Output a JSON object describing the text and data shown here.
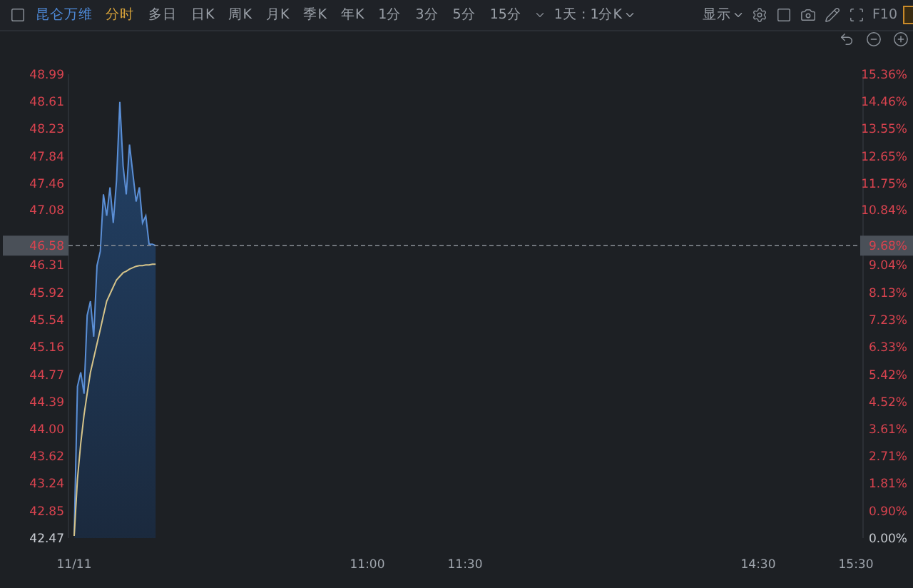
{
  "toolbar": {
    "stock_name": "昆仑万维",
    "tabs": [
      {
        "label": "分时",
        "selected": true
      },
      {
        "label": "多日",
        "selected": false
      },
      {
        "label": "日K",
        "selected": false
      },
      {
        "label": "周K",
        "selected": false
      },
      {
        "label": "月K",
        "selected": false
      },
      {
        "label": "季K",
        "selected": false
      },
      {
        "label": "年K",
        "selected": false
      },
      {
        "label": "1分",
        "selected": false
      },
      {
        "label": "3分",
        "selected": false
      },
      {
        "label": "5分",
        "selected": false
      },
      {
        "label": "15分",
        "selected": false
      }
    ],
    "period_select": "1天 : 1分K",
    "display_menu": "显示",
    "f10": "F10"
  },
  "chart": {
    "chart_data": {
      "type": "line",
      "categories": [
        "11/11",
        null,
        null,
        null,
        null,
        null,
        null,
        null,
        null,
        null,
        null,
        null,
        null,
        null,
        null,
        null,
        null,
        null,
        null,
        null,
        null,
        null,
        null,
        null,
        null,
        null,
        null,
        null,
        null,
        null,
        null,
        null,
        null,
        null,
        null,
        null,
        null,
        null,
        null,
        null,
        null,
        null,
        null,
        null,
        null,
        null,
        null,
        null,
        null,
        null,
        null,
        null,
        null,
        null,
        null,
        null,
        null,
        null,
        null,
        null,
        null,
        null,
        null,
        null,
        null,
        null,
        null,
        null,
        null,
        null,
        null,
        null,
        null,
        null,
        null,
        null,
        null,
        null,
        null,
        null,
        null,
        null,
        null,
        null,
        null,
        null,
        null,
        null,
        null,
        null,
        "11:00",
        null,
        null,
        null,
        null,
        null,
        null,
        null,
        null,
        null,
        null,
        null,
        null,
        null,
        null,
        null,
        null,
        null,
        null,
        null,
        null,
        null,
        null,
        null,
        null,
        null,
        null,
        null,
        null,
        null,
        "11:30",
        null,
        null,
        null,
        null,
        null,
        null,
        null,
        null,
        null,
        null,
        null,
        null,
        null,
        null,
        null,
        null,
        null,
        null,
        null,
        null,
        null,
        null,
        null,
        null,
        null,
        null,
        null,
        null,
        null,
        null,
        null,
        null,
        null,
        null,
        null,
        null,
        null,
        null,
        null,
        null,
        null,
        null,
        null,
        null,
        null,
        null,
        null,
        null,
        null,
        null,
        null,
        null,
        null,
        null,
        null,
        null,
        null,
        null,
        null,
        null,
        null,
        null,
        null,
        null,
        null,
        null,
        null,
        null,
        null,
        null,
        null,
        null,
        null,
        null,
        null,
        null,
        null,
        null,
        null,
        null,
        null,
        null,
        null,
        null,
        null,
        null,
        null,
        null,
        null,
        "14:30",
        null,
        null,
        null,
        null,
        null,
        null,
        null,
        null,
        null,
        null,
        null,
        null,
        null,
        null,
        null,
        null,
        null,
        null,
        null,
        null,
        null,
        null,
        null,
        null,
        null,
        null,
        null,
        null,
        null,
        "15:30"
      ],
      "series": [
        {
          "color": "#5b8fd6",
          "values": [
            42.5,
            44.6,
            44.8,
            44.5,
            45.6,
            45.8,
            45.3,
            46.3,
            46.5,
            47.3,
            47.0,
            47.4,
            46.9,
            47.5,
            48.6,
            47.7,
            47.3,
            48.0,
            47.6,
            47.2,
            47.4,
            46.9,
            47.0,
            46.6,
            46.6,
            46.58,
            null,
            null,
            null,
            null,
            null,
            null,
            null,
            null,
            null,
            null,
            null,
            null,
            null,
            null,
            null,
            null,
            null,
            null,
            null,
            null,
            null,
            null,
            null,
            null,
            null,
            null,
            null,
            null,
            null,
            null,
            null,
            null,
            null,
            null,
            null,
            null,
            null,
            null,
            null,
            null,
            null,
            null,
            null,
            null,
            null,
            null,
            null,
            null,
            null,
            null,
            null,
            null,
            null,
            null,
            null,
            null,
            null,
            null,
            null,
            null,
            null,
            null,
            null,
            null,
            null,
            null,
            null,
            null,
            null,
            null,
            null,
            null,
            null,
            null,
            null,
            null,
            null,
            null,
            null,
            null,
            null,
            null,
            null,
            null,
            null,
            null,
            null,
            null,
            null,
            null,
            null,
            null,
            null,
            null,
            null,
            null,
            null,
            null,
            null,
            null,
            null,
            null,
            null,
            null,
            null,
            null,
            null,
            null,
            null,
            null,
            null,
            null,
            null,
            null,
            null,
            null,
            null,
            null,
            null,
            null,
            null,
            null,
            null,
            null,
            null,
            null,
            null,
            null,
            null,
            null,
            null,
            null,
            null,
            null,
            null,
            null,
            null,
            null,
            null,
            null,
            null,
            null,
            null,
            null,
            null,
            null,
            null,
            null,
            null,
            null,
            null,
            null,
            null,
            null,
            null,
            null,
            null,
            null,
            null,
            null,
            null,
            null,
            null,
            null,
            null,
            null,
            null,
            null,
            null,
            null,
            null,
            null,
            null,
            null,
            null,
            null,
            null,
            null,
            null,
            null,
            null,
            null,
            null,
            null,
            null,
            null,
            null,
            null,
            null,
            null,
            null,
            null,
            null,
            null,
            null,
            null,
            null,
            null,
            null,
            null,
            null,
            null,
            null,
            null,
            null,
            null,
            null,
            null,
            null,
            null,
            null,
            null,
            null,
            null,
            null
          ]
        },
        {
          "color": "#d6c48a",
          "values": [
            42.5,
            43.3,
            43.8,
            44.2,
            44.5,
            44.8,
            45.0,
            45.2,
            45.4,
            45.6,
            45.8,
            45.9,
            46.0,
            46.1,
            46.15,
            46.2,
            46.22,
            46.25,
            46.27,
            46.29,
            46.3,
            46.3,
            46.31,
            46.31,
            46.32,
            46.32,
            null,
            null,
            null,
            null,
            null,
            null,
            null,
            null,
            null,
            null,
            null,
            null,
            null,
            null,
            null,
            null,
            null,
            null,
            null,
            null,
            null,
            null,
            null,
            null,
            null,
            null,
            null,
            null,
            null,
            null,
            null,
            null,
            null,
            null,
            null,
            null,
            null,
            null,
            null,
            null,
            null,
            null,
            null,
            null,
            null,
            null,
            null,
            null,
            null,
            null,
            null,
            null,
            null,
            null,
            null,
            null,
            null,
            null,
            null,
            null,
            null,
            null,
            null,
            null,
            null,
            null,
            null,
            null,
            null,
            null,
            null,
            null,
            null,
            null,
            null,
            null,
            null,
            null,
            null,
            null,
            null,
            null,
            null,
            null,
            null,
            null,
            null,
            null,
            null,
            null,
            null,
            null,
            null,
            null,
            null,
            null,
            null,
            null,
            null,
            null,
            null,
            null,
            null,
            null,
            null,
            null,
            null,
            null,
            null,
            null,
            null,
            null,
            null,
            null,
            null,
            null,
            null,
            null,
            null,
            null,
            null,
            null,
            null,
            null,
            null,
            null,
            null,
            null,
            null,
            null,
            null,
            null,
            null,
            null,
            null,
            null,
            null,
            null,
            null,
            null,
            null,
            null,
            null,
            null,
            null,
            null,
            null,
            null,
            null,
            null,
            null,
            null,
            null,
            null,
            null,
            null,
            null,
            null,
            null,
            null,
            null,
            null,
            null,
            null,
            null,
            null,
            null,
            null,
            null,
            null,
            null,
            null,
            null,
            null,
            null,
            null,
            null,
            null,
            null,
            null,
            null,
            null,
            null,
            null,
            null,
            null,
            null,
            null,
            null,
            null,
            null,
            null,
            null,
            null,
            null,
            null,
            null,
            null,
            null,
            null,
            null,
            null,
            null,
            null,
            null,
            null,
            null,
            null,
            null,
            null,
            null,
            null,
            null,
            null,
            null
          ]
        }
      ],
      "ylim": [
        42.47,
        48.99
      ],
      "yticks": [
        {
          "value": 48.99,
          "label": "48.99"
        },
        {
          "value": 48.61,
          "label": "48.61"
        },
        {
          "value": 48.23,
          "label": "48.23"
        },
        {
          "value": 47.84,
          "label": "47.84"
        },
        {
          "value": 47.46,
          "label": "47.46"
        },
        {
          "value": 47.08,
          "label": "47.08"
        },
        {
          "value": 46.31,
          "label": "46.31"
        },
        {
          "value": 45.92,
          "label": "45.92"
        },
        {
          "value": 45.54,
          "label": "45.54"
        },
        {
          "value": 45.16,
          "label": "45.16"
        },
        {
          "value": 44.77,
          "label": "44.77"
        },
        {
          "value": 44.39,
          "label": "44.39"
        },
        {
          "value": 44.0,
          "label": "44.00"
        },
        {
          "value": 43.62,
          "label": "43.62"
        },
        {
          "value": 43.24,
          "label": "43.24"
        },
        {
          "value": 42.85,
          "label": "42.85"
        },
        {
          "value": 42.47,
          "label": "42.47"
        }
      ],
      "ref_lines": [
        {
          "axis": "y",
          "value": 46.58,
          "label": "46.58"
        }
      ]
    },
    "percent_axis": [
      "15.36%",
      "14.46%",
      "13.55%",
      "12.65%",
      "11.75%",
      "10.84%",
      "9.04%",
      "8.13%",
      "7.23%",
      "6.33%",
      "5.42%",
      "4.52%",
      "3.61%",
      "2.71%",
      "1.81%",
      "0.90%",
      "0.00%"
    ],
    "crosshair_percent": "9.68%"
  }
}
